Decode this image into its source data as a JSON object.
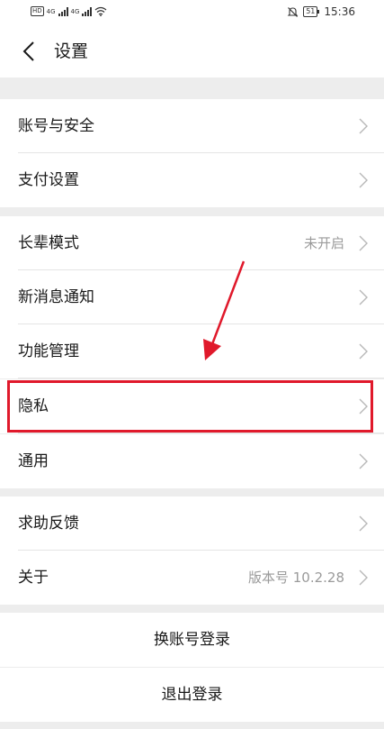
{
  "status_bar": {
    "signal_label_1": "4G",
    "signal_label_2": "4G",
    "battery": "51",
    "time": "15:36"
  },
  "nav": {
    "title": "设置"
  },
  "groups": [
    {
      "items": [
        {
          "label": "账号与安全"
        },
        {
          "label": "支付设置"
        }
      ]
    },
    {
      "items": [
        {
          "label": "长辈模式",
          "value": "未开启"
        },
        {
          "label": "新消息通知"
        },
        {
          "label": "功能管理"
        },
        {
          "label": "隐私"
        },
        {
          "label": "通用"
        }
      ]
    },
    {
      "items": [
        {
          "label": "求助反馈"
        },
        {
          "label": "关于",
          "value": "版本号 10.2.28"
        }
      ]
    }
  ],
  "actions": {
    "switch_account": "换账号登录",
    "logout": "退出登录"
  },
  "annotation": {
    "color": "#e0192b"
  }
}
